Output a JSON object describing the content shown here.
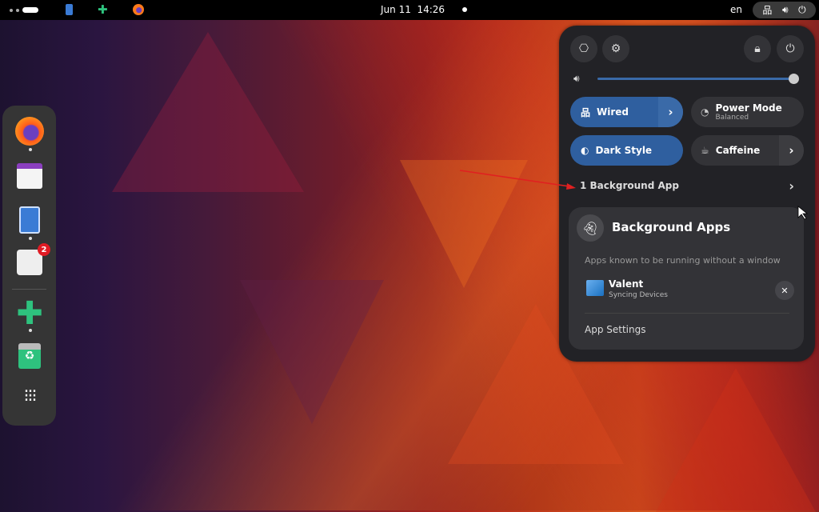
{
  "topbar": {
    "clock": "Jun 11  14:26",
    "language": "en",
    "icons": [
      "workspaces-indicator",
      "files-icon",
      "extensions-icon",
      "firefox-icon",
      "network-wired-icon",
      "volume-icon",
      "power-icon"
    ]
  },
  "dock": {
    "apps": [
      {
        "name": "Firefox",
        "running": true
      },
      {
        "name": "Calendar",
        "running": false
      },
      {
        "name": "Files",
        "running": true
      },
      {
        "name": "Software",
        "running": false,
        "badge": "2"
      },
      {
        "name": "Extensions",
        "running": true
      },
      {
        "name": "Trash",
        "running": false
      }
    ],
    "show_apps": "app-grid-icon"
  },
  "quick_settings": {
    "volume_level": 1.0,
    "tiles": [
      {
        "label": "Wired",
        "active": true,
        "has_menu": true
      },
      {
        "label": "Power Mode",
        "subtitle": "Balanced",
        "active": false
      },
      {
        "label": "Dark Style",
        "active": true
      },
      {
        "label": "Caffeine",
        "active": false,
        "has_menu": true
      }
    ],
    "background_apps_label": "1 Background App",
    "submenu": {
      "title": "Background Apps",
      "description": "Apps known to be running without a window",
      "apps": [
        {
          "name": "Valent",
          "status": "Syncing Devices"
        }
      ],
      "settings_label": "App Settings"
    }
  },
  "colors": {
    "accent": "#2f5f9f",
    "annotation_arrow": "#e02020",
    "badge": "#e01b24"
  }
}
